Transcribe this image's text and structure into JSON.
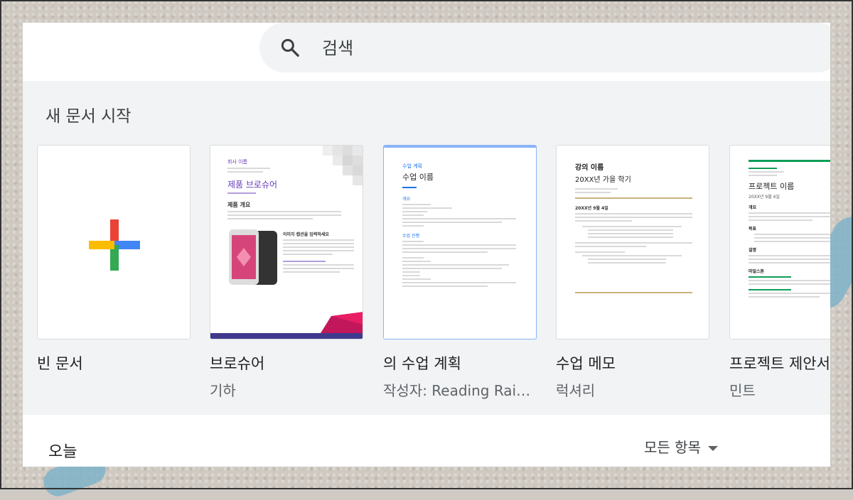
{
  "search": {
    "placeholder": "검색",
    "icon": "search-icon"
  },
  "gallery": {
    "title": "새 문서 시작",
    "templates": [
      {
        "name": "빈 문서",
        "subtitle": "",
        "thumbnail": {}
      },
      {
        "name": "브로슈어",
        "subtitle": "기하",
        "thumbnail": {
          "company": "회사 이름",
          "heading": "제품 브로슈어",
          "section": "제품 개요",
          "subheading": "이미지 캡션을 입력하세요"
        }
      },
      {
        "name": "의 수업 계획",
        "subtitle": "작성자: Reading Rai…",
        "thumbnail": {
          "kicker": "수업 계획",
          "heading": "수업 이름",
          "section1": "개요",
          "section2": "수업 진행"
        }
      },
      {
        "name": "수업 메모",
        "subtitle": "럭셔리",
        "thumbnail": {
          "heading": "강의 이름",
          "subheading": "20XX년 가을 학기",
          "date": "20XX년 9월 4일"
        }
      },
      {
        "name": "프로젝트 제안서",
        "subtitle": "민트",
        "thumbnail": {
          "heading": "프로젝트 이름",
          "date": "20XX년 9월 4일",
          "section1": "개요",
          "section2": "목표",
          "section3": "설명",
          "section4": "마일스톤"
        }
      }
    ]
  },
  "recent": {
    "title": "오늘",
    "filter_label": "모든 항목"
  },
  "colors": {
    "accent_blue": "#4285f4",
    "brochure_purple": "#673ab7",
    "lesson_blue": "#1a73e8",
    "mint": "#0f9d58"
  }
}
